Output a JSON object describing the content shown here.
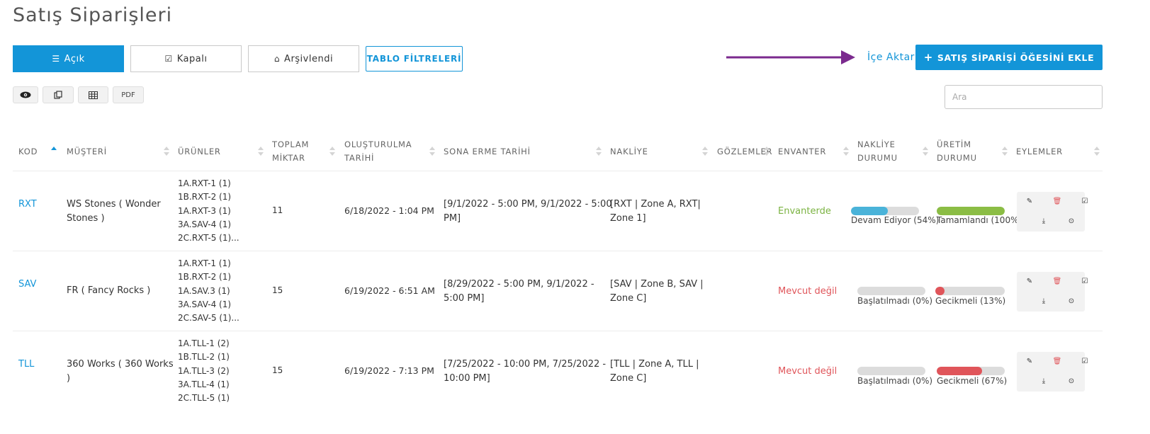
{
  "page": {
    "title": "Satış Siparişleri"
  },
  "tabs": [
    {
      "label": "Açık",
      "icon": "list-icon",
      "active": true
    },
    {
      "label": "Kapalı",
      "icon": "check-square-icon",
      "active": false
    },
    {
      "label": "Arşivlendi",
      "icon": "inbox-icon",
      "active": false
    }
  ],
  "filter_button": "TABLO FİLTRELERİ",
  "import_link": "İçe Aktar",
  "add_button": "SATIŞ SİPARİŞİ ÖĞESİNİ EKLE",
  "toolbar": {
    "view_icon": "eye-icon",
    "copy_icon": "copy-icon",
    "table_icon": "table-icon",
    "pdf_label": "PDF"
  },
  "search": {
    "placeholder": "Ara"
  },
  "colors": {
    "accent": "#1395d8",
    "success": "#7bb342",
    "danger": "#e0555a",
    "arrow": "#7b2a8e",
    "progress_blue": "#4ab3d9"
  },
  "columns": [
    {
      "line1": "KOD",
      "line2": ""
    },
    {
      "line1": "MÜŞTERİ",
      "line2": ""
    },
    {
      "line1": "ÜRÜNLER",
      "line2": ""
    },
    {
      "line1": "TOPLAM",
      "line2": "MİKTAR"
    },
    {
      "line1": "OLUŞTURULMA",
      "line2": "TARİHİ"
    },
    {
      "line1": "SONA ERME TARİHİ",
      "line2": ""
    },
    {
      "line1": "NAKLİYE",
      "line2": ""
    },
    {
      "line1": "GÖZLEMLER",
      "line2": ""
    },
    {
      "line1": "ENVANTER",
      "line2": ""
    },
    {
      "line1": "NAKLİYE",
      "line2": "DURUMU"
    },
    {
      "line1": "ÜRETİM",
      "line2": "DURUMU"
    },
    {
      "line1": "EYLEMLER",
      "line2": ""
    }
  ],
  "rows": [
    {
      "code": "RXT",
      "customer_1": "WS Stones ( Wonder",
      "customer_2": "Stones )",
      "products": [
        "1A.RXT-1 (1)",
        "1B.RXT-2 (1)",
        "1A.RXT-3 (1)",
        "3A.SAV-4 (1)",
        "2C.RXT-5 (1)..."
      ],
      "total": "11",
      "created": "6/18/2022 - 1:04 PM",
      "expiry_1": "[9/1/2022 - 5:00 PM, 9/1/2022 - 5:00",
      "expiry_2": "PM]",
      "shipping_1": "[RXT | Zone A, RXT|",
      "shipping_2": "Zone 1]",
      "notes": "",
      "inventory": "Envanterde",
      "inventory_ok": true,
      "ship_status": {
        "label": "Devam Ediyor (54%)",
        "percent": 54,
        "color": "#4ab3d9"
      },
      "prod_status": {
        "label": "Tamamlandı (100%)",
        "percent": 100,
        "color": "#8bbd45"
      }
    },
    {
      "code": "SAV",
      "customer_1": "FR ( Fancy Rocks )",
      "customer_2": "",
      "products": [
        "1A.RXT-1 (1)",
        "1B.RXT-2 (1)",
        "1A.SAV.3 (1)",
        "3A.SAV-4 (1)",
        "2C.SAV-5 (1)..."
      ],
      "total": "15",
      "created": "6/19/2022 - 6:51 AM",
      "expiry_1": "[8/29/2022 - 5:00 PM, 9/1/2022 -",
      "expiry_2": "5:00 PM]",
      "shipping_1": "[SAV | Zone B, SAV |",
      "shipping_2": "Zone C]",
      "notes": "",
      "inventory": "Mevcut değil",
      "inventory_ok": false,
      "ship_status": {
        "label": "Başlatılmadı (0%)",
        "percent": 0,
        "color": "#4ab3d9"
      },
      "prod_status": {
        "label": "Gecikmeli (13%)",
        "percent": 13,
        "color": "#e0555a"
      }
    },
    {
      "code": "TLL",
      "customer_1": "360 Works ( 360 Works",
      "customer_2": ")",
      "products": [
        "1A.TLL-1 (2)",
        "1B.TLL-2 (1)",
        "1A.TLL-3 (2)",
        "3A.TLL-4 (1)",
        "2C.TLL-5 (1)"
      ],
      "total": "15",
      "created": "6/19/2022 - 7:13 PM",
      "expiry_1": "[7/25/2022 - 10:00 PM, 7/25/2022 -",
      "expiry_2": "10:00 PM]",
      "shipping_1": "[TLL | Zone A, TLL |",
      "shipping_2": "Zone C]",
      "notes": "",
      "inventory": "Mevcut değil",
      "inventory_ok": false,
      "ship_status": {
        "label": "Başlatılmadı (0%)",
        "percent": 0,
        "color": "#4ab3d9"
      },
      "prod_status": {
        "label": "Gecikmeli (67%)",
        "percent": 67,
        "color": "#e0555a"
      }
    }
  ]
}
